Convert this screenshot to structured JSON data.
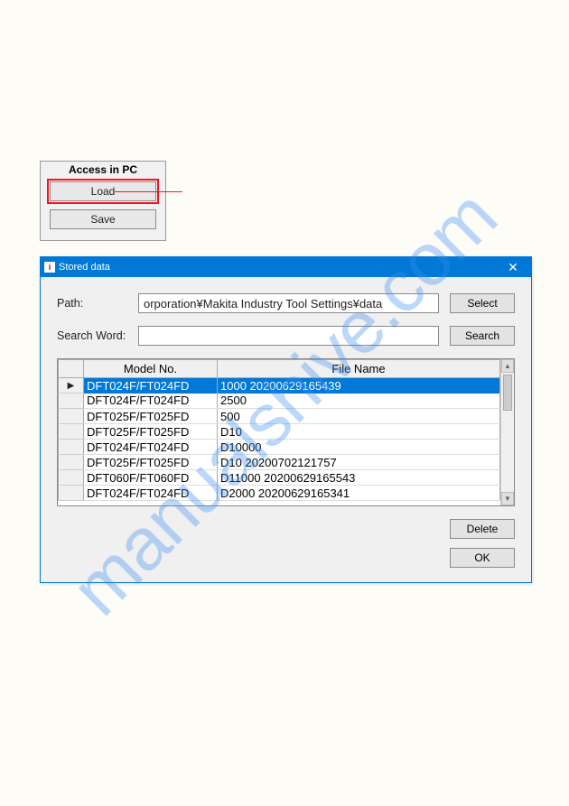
{
  "watermark": "manualshive.com",
  "access_panel": {
    "title": "Access in PC",
    "load_label": "Load",
    "save_label": "Save"
  },
  "dialog": {
    "title": "Stored data",
    "path_label": "Path:",
    "path_value": "orporation¥Makita Industry Tool Settings¥data",
    "select_label": "Select",
    "search_label": "Search Word:",
    "search_value": "",
    "search_btn_label": "Search",
    "delete_label": "Delete",
    "ok_label": "OK",
    "columns": {
      "model": "Model No.",
      "file": "File Name"
    },
    "rows": [
      {
        "marker": "▶",
        "model": "DFT024F/FT024FD",
        "file": "1000 20200629165439",
        "selected": true
      },
      {
        "marker": "",
        "model": "DFT024F/FT024FD",
        "file": "2500",
        "selected": false
      },
      {
        "marker": "",
        "model": "DFT025F/FT025FD",
        "file": "500",
        "selected": false
      },
      {
        "marker": "",
        "model": "DFT025F/FT025FD",
        "file": "D10",
        "selected": false
      },
      {
        "marker": "",
        "model": "DFT024F/FT024FD",
        "file": "D10000",
        "selected": false
      },
      {
        "marker": "",
        "model": "DFT025F/FT025FD",
        "file": "D10 20200702121757",
        "selected": false
      },
      {
        "marker": "",
        "model": "DFT060F/FT060FD",
        "file": "D11000 20200629165543",
        "selected": false
      },
      {
        "marker": "",
        "model": "DFT024F/FT024FD",
        "file": "D2000 20200629165341",
        "selected": false
      }
    ]
  }
}
